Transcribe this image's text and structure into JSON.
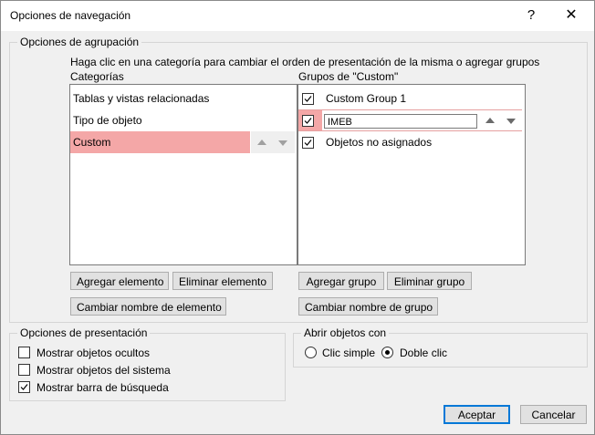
{
  "window": {
    "title": "Opciones de navegación",
    "help": "?",
    "close": "✕"
  },
  "grouping": {
    "legend": "Opciones de agrupación",
    "instruction": "Haga clic en una categoría para cambiar el orden de presentación de la misma o agregar grupos",
    "categories_label": "Categorías",
    "groups_label": "Grupos de \"Custom\"",
    "categories": [
      "Tablas y vistas relacionadas",
      "Tipo de objeto",
      "Custom"
    ],
    "groups": [
      {
        "label": "Custom Group 1",
        "checked": true
      },
      {
        "label": "IMEB",
        "checked": true,
        "editing": true
      },
      {
        "label": "Objetos no asignados",
        "checked": true
      }
    ],
    "buttons": {
      "add_item": "Agregar elemento",
      "delete_item": "Eliminar elemento",
      "rename_item": "Cambiar nombre de elemento",
      "add_group": "Agregar grupo",
      "delete_group": "Eliminar grupo",
      "rename_group": "Cambiar nombre de grupo"
    }
  },
  "display": {
    "legend": "Opciones de presentación",
    "options": [
      {
        "label": "Mostrar objetos ocultos",
        "checked": false
      },
      {
        "label": "Mostrar objetos del sistema",
        "checked": false
      },
      {
        "label": "Mostrar barra de búsqueda",
        "checked": true
      }
    ]
  },
  "open": {
    "legend": "Abrir objetos con",
    "single": "Clic simple",
    "double": "Doble clic",
    "selected": "Doble clic"
  },
  "footer": {
    "ok": "Aceptar",
    "cancel": "Cancelar"
  },
  "colors": {
    "selection": "#f4a7a7",
    "default_button_border": "#0078d7"
  }
}
